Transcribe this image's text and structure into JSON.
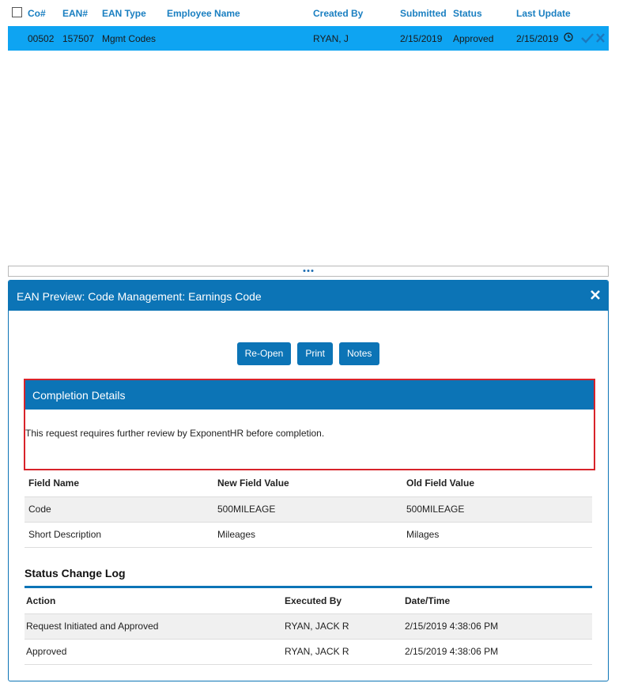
{
  "grid": {
    "columns": [
      "Co#",
      "EAN#",
      "EAN Type",
      "Employee Name",
      "Created By",
      "Submitted",
      "Status",
      "Last Update"
    ],
    "selected_row": {
      "co": "00502",
      "ean": "157507",
      "ean_type": "Mgmt Codes",
      "employee_name": "",
      "created_by": "RYAN, J",
      "submitted": "2/15/2019",
      "status": "Approved",
      "last_update": "2/15/2019"
    },
    "row_icons": [
      "clock-icon",
      "check-icon",
      "x-icon"
    ]
  },
  "splitter": {
    "icon": "ellipsis-icon"
  },
  "panel": {
    "title": "EAN Preview: Code Management: Earnings Code",
    "close_icon": "close-icon",
    "buttons": {
      "reopen": "Re-Open",
      "print": "Print",
      "notes": "Notes"
    },
    "completion": {
      "title": "Completion Details",
      "text": "This request requires further review by ExponentHR before completion."
    },
    "fields": {
      "headers": [
        "Field Name",
        "New Field Value",
        "Old Field Value"
      ],
      "rows": [
        [
          "Code",
          "500MILEAGE",
          "500MILEAGE"
        ],
        [
          "Short Description",
          "Mileages",
          "Milages"
        ]
      ]
    },
    "log": {
      "title": "Status Change Log",
      "headers": [
        "Action",
        "Executed By",
        "Date/Time"
      ],
      "rows": [
        [
          "Request Initiated and Approved",
          "RYAN, JACK R",
          "2/15/2019 4:38:06 PM"
        ],
        [
          "Approved",
          "RYAN, JACK R",
          "2/15/2019 4:38:06 PM"
        ]
      ]
    }
  },
  "colors": {
    "accent": "#0c74b6",
    "header_link": "#1a7fc1",
    "selected_row": "#0ea4f2",
    "highlight_border": "#d8232a"
  }
}
